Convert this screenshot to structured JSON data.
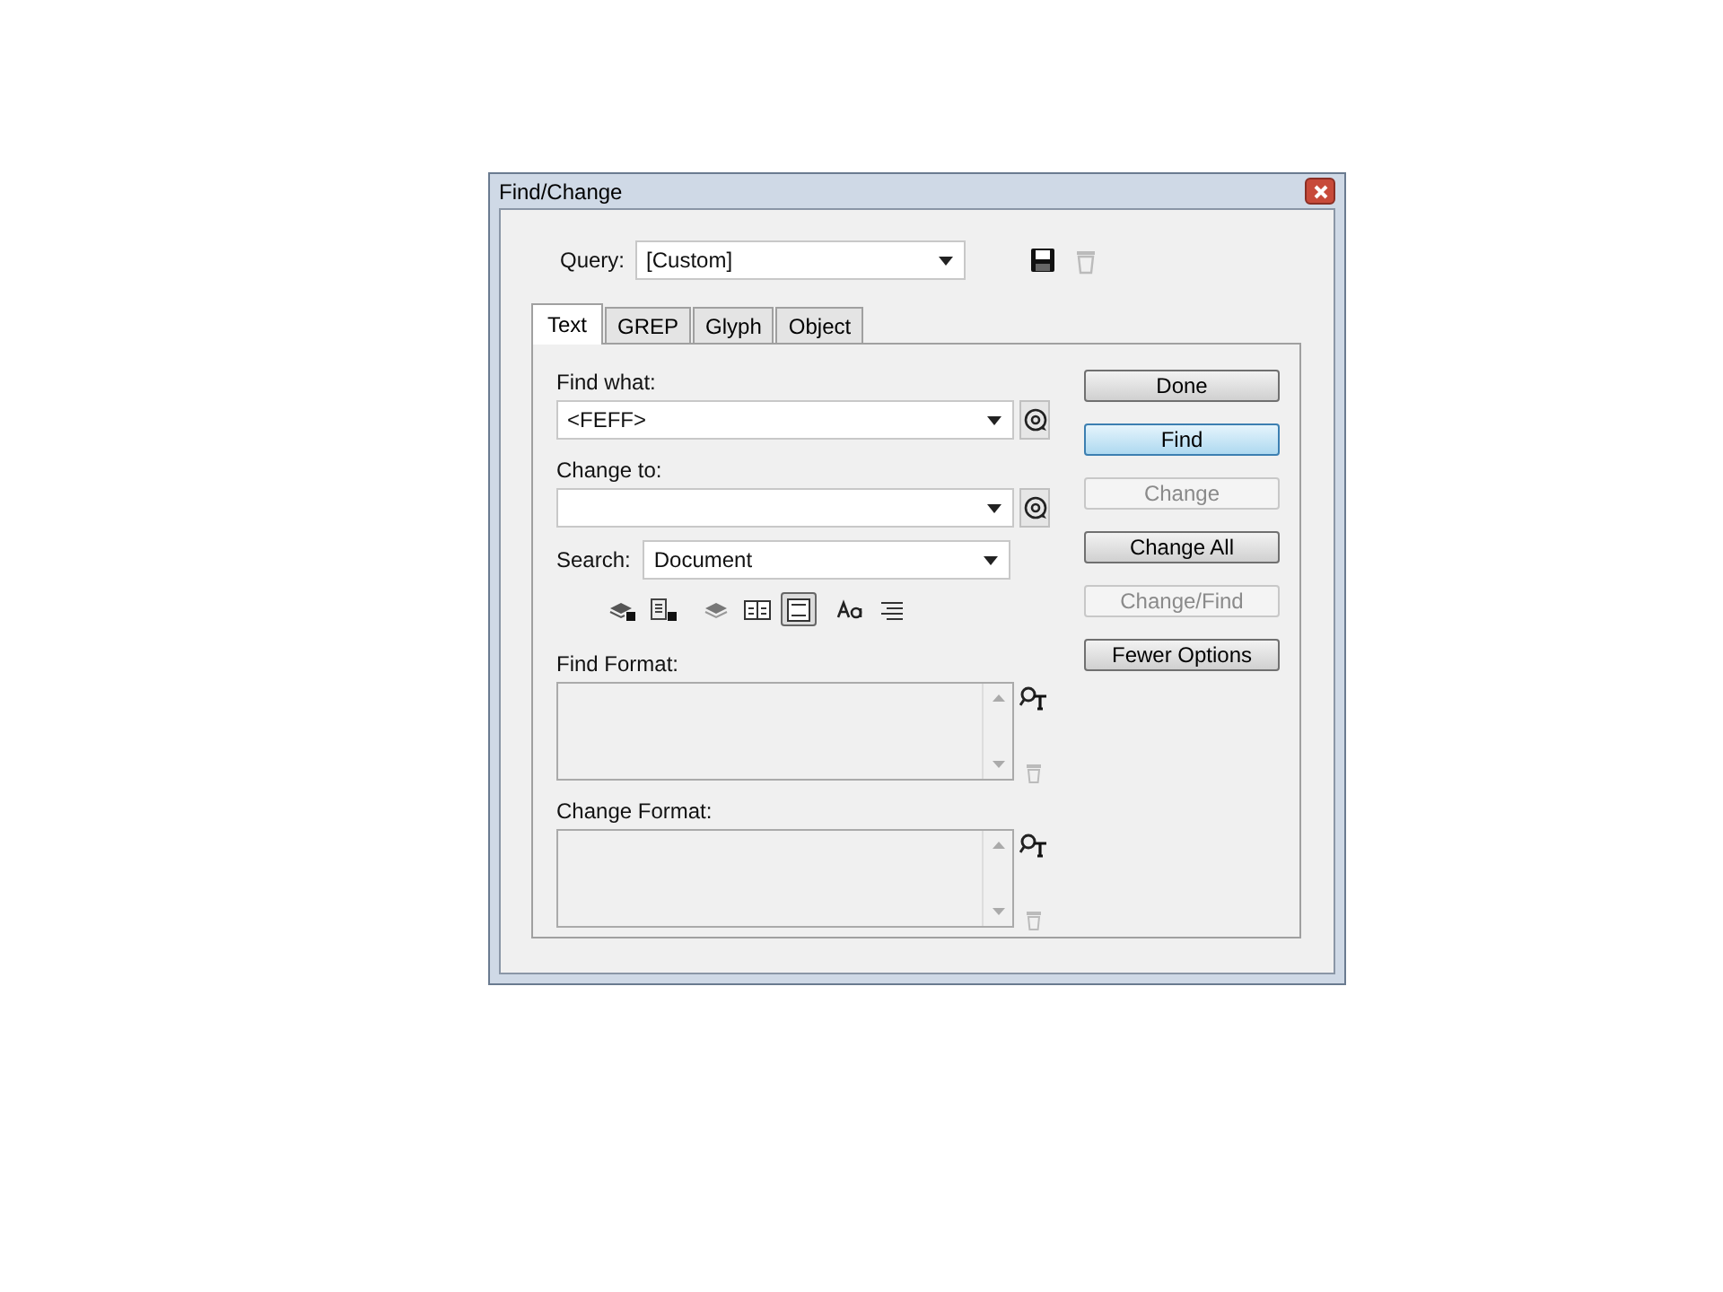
{
  "window": {
    "title": "Find/Change"
  },
  "query": {
    "label": "Query:",
    "value": "[Custom]"
  },
  "tabs": [
    {
      "label": "Text",
      "selected": true
    },
    {
      "label": "GREP",
      "selected": false
    },
    {
      "label": "Glyph",
      "selected": false
    },
    {
      "label": "Object",
      "selected": false
    }
  ],
  "find_what": {
    "label": "Find what:",
    "value": "<FEFF>"
  },
  "change_to": {
    "label": "Change to:"
  },
  "search": {
    "label": "Search:",
    "value": "Document"
  },
  "search_options": [
    {
      "on": false
    },
    {
      "on": false
    },
    {
      "on": false
    },
    {
      "on": false
    },
    {
      "on": true
    },
    {
      "on": false
    },
    {
      "on": false
    }
  ],
  "find_format": {
    "label": "Find Format:"
  },
  "change_format": {
    "label": "Change Format:"
  },
  "buttons": [
    {
      "label": "Done",
      "disabled": false,
      "focused": false
    },
    {
      "label": "Find",
      "disabled": false,
      "focused": true
    },
    {
      "label": "Change",
      "disabled": true,
      "focused": false
    },
    {
      "label": "Change All",
      "disabled": false,
      "focused": false
    },
    {
      "label": "Change/Find",
      "disabled": true,
      "focused": false
    },
    {
      "label": "Fewer Options",
      "disabled": false,
      "focused": false
    }
  ]
}
